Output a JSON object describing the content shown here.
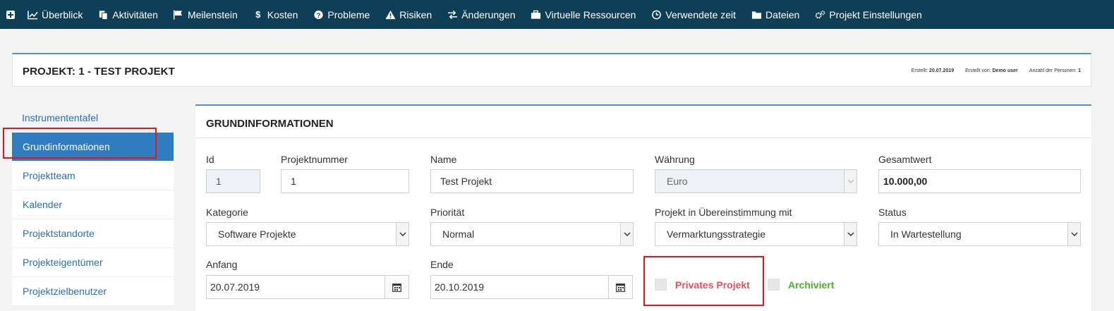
{
  "nav": {
    "items": [
      {
        "icon": "chart-line-icon",
        "label": "Überblick"
      },
      {
        "icon": "copy-icon",
        "label": "Aktivitäten"
      },
      {
        "icon": "flag-icon",
        "label": "Meilenstein"
      },
      {
        "icon": "dollar-icon",
        "label": "Kosten"
      },
      {
        "icon": "question-circle-icon",
        "label": "Probleme"
      },
      {
        "icon": "warning-icon",
        "label": "Risiken"
      },
      {
        "icon": "exchange-icon",
        "label": "Änderungen"
      },
      {
        "icon": "briefcase-icon",
        "label": "Virtuelle Ressourcen"
      },
      {
        "icon": "clock-icon",
        "label": "Verwendete zeit"
      },
      {
        "icon": "folder-icon",
        "label": "Dateien"
      },
      {
        "icon": "cogs-icon",
        "label": "Projekt Einstellungen"
      }
    ]
  },
  "header": {
    "title": "PROJEKT: 1 - TEST PROJEKT",
    "created_label": "Erstellt:",
    "created_value": "20.07.2019",
    "created_by_label": "Erstellt von:",
    "created_by_value": "Demo user",
    "persons_label": "Anzahl der Personen:",
    "persons_value": "1"
  },
  "sidebar": {
    "items": [
      {
        "label": "Instrumententafel"
      },
      {
        "label": "Grundinformationen"
      },
      {
        "label": "Projektteam"
      },
      {
        "label": "Kalender"
      },
      {
        "label": "Projektstandorte"
      },
      {
        "label": "Projekteigentümer"
      },
      {
        "label": "Projektzielbenutzer"
      }
    ]
  },
  "main": {
    "title": "GRUNDINFORMATIONEN",
    "id_label": "Id",
    "id_value": "1",
    "projektnummer_label": "Projektnummer",
    "projektnummer_value": "1",
    "name_label": "Name",
    "name_value": "Test Projekt",
    "waehrung_label": "Währung",
    "waehrung_value": "Euro",
    "gesamtwert_label": "Gesamtwert",
    "gesamtwert_value": "10.000,00",
    "kategorie_label": "Kategorie",
    "kategorie_value": "Software Projekte",
    "prioritaet_label": "Priorität",
    "prioritaet_value": "Normal",
    "uebereinstimmung_label": "Projekt in Übereinstimmung mit",
    "uebereinstimmung_value": "Vermarktungsstrategie",
    "status_label": "Status",
    "status_value": "In Wartestellung",
    "anfang_label": "Anfang",
    "anfang_value": "20.07.2019",
    "ende_label": "Ende",
    "ende_value": "20.10.2019",
    "privat_label": "Privates Projekt",
    "archiviert_label": "Archiviert"
  },
  "colors": {
    "nav_bg": "#0f3f56",
    "accent_blue": "#2f7cc0",
    "highlight_red": "#e8141c",
    "privat_text": "#e0505e",
    "archiviert_text": "#4caf2a"
  }
}
